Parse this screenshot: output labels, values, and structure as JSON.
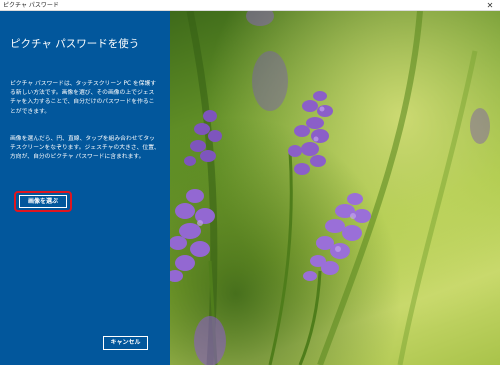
{
  "window": {
    "title": "ピクチャ パスワード",
    "close_glyph": "✕"
  },
  "panel": {
    "heading": "ピクチャ パスワードを使う",
    "paragraph1": "ピクチャ パスワードは、タッチスクリーン PC を保護する新しい方法です。画像を選び、その画像の上でジェスチャを入力することで、自分だけのパスワードを作ることができます。",
    "paragraph2": "画像を選んだら、円、直線、タップを組み合わせてタッチスクリーンをなぞります。ジェスチャの大きさ、位置、方向が、自分のピクチャ パスワードに含まれます。",
    "choose_picture_label": "画像を選ぶ",
    "cancel_label": "キャンセル",
    "background_color": "#02579c",
    "highlight_color": "#e0161f"
  },
  "photo": {
    "subject": "lavender-flowers-image"
  }
}
